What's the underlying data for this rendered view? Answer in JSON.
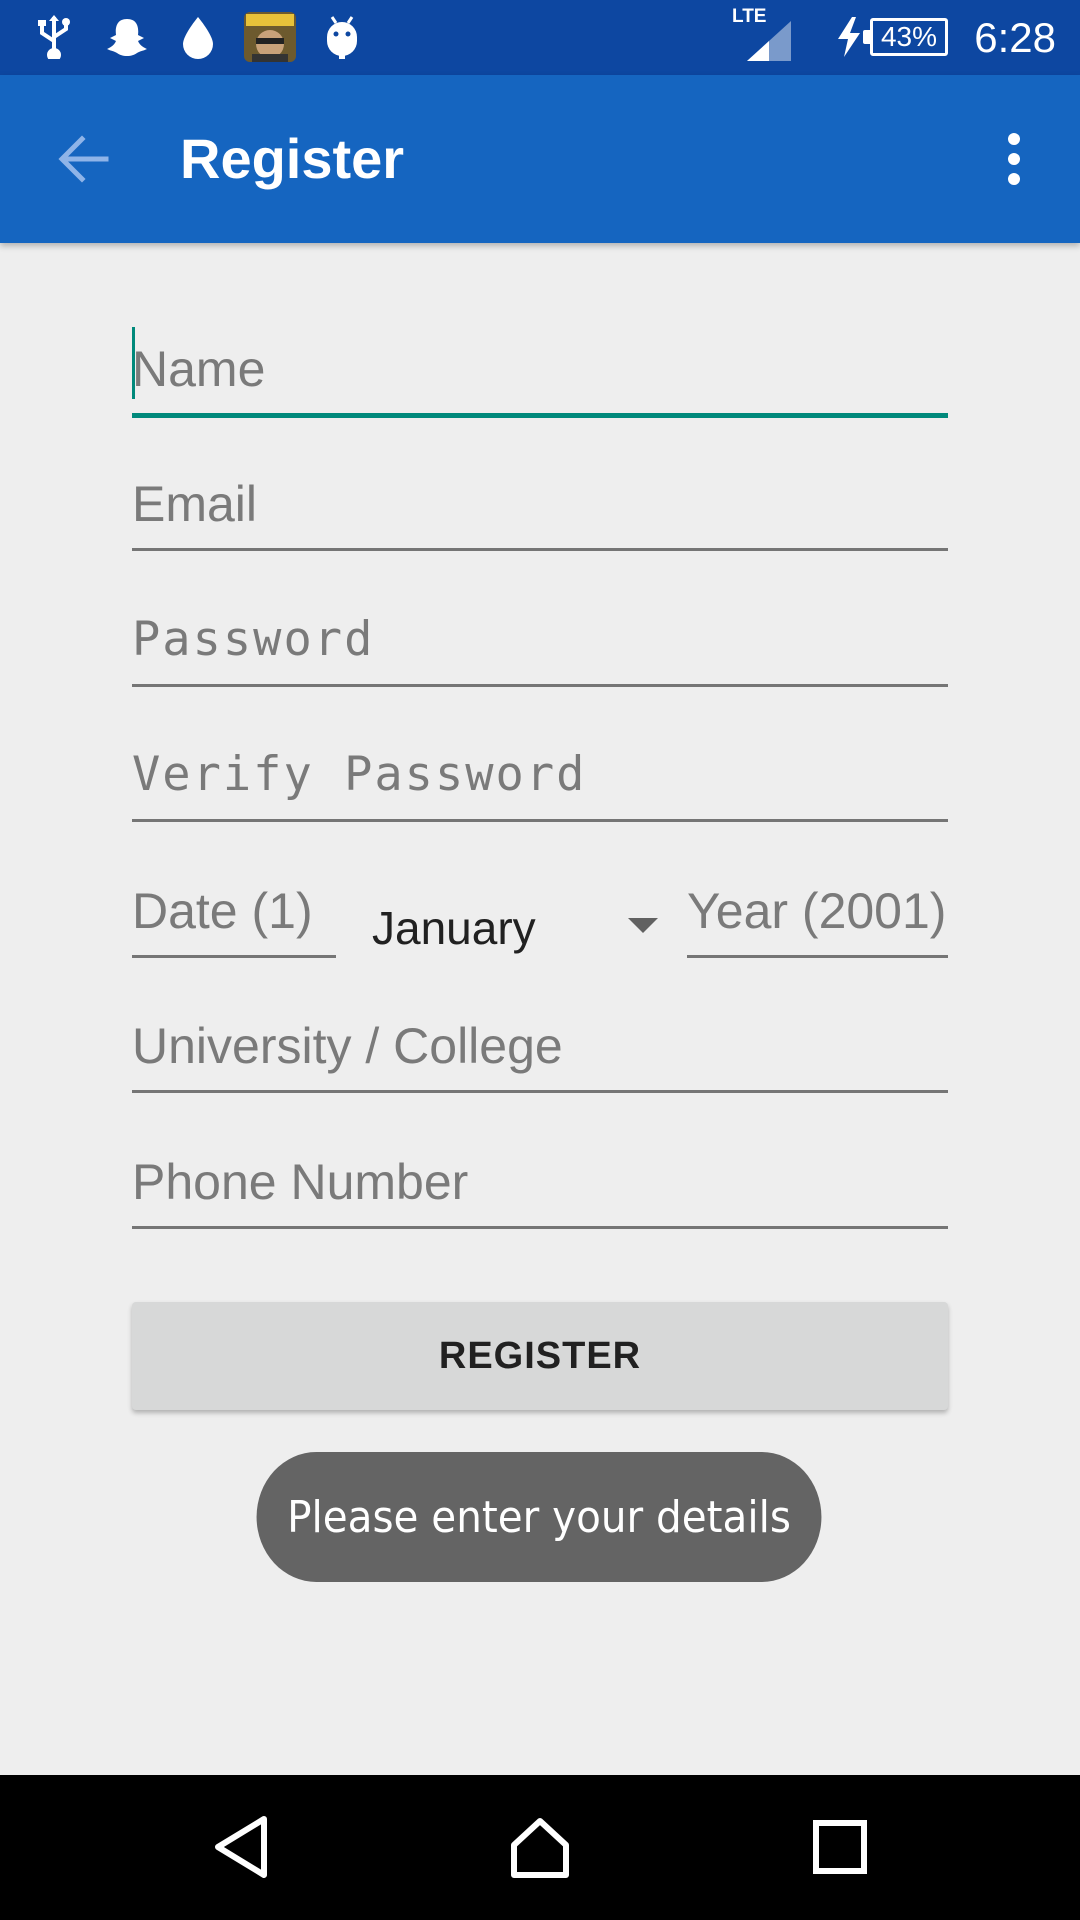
{
  "status_bar": {
    "time": "6:28",
    "battery": "43%",
    "network": "LTE",
    "left_icons": [
      "usb-icon",
      "snapchat-icon",
      "drop-icon",
      "game-app-icon",
      "android-icon"
    ],
    "right_icons": [
      "signal-icon",
      "charging-icon",
      "battery-icon"
    ]
  },
  "app_bar": {
    "title": "Register",
    "back_icon": "arrow-back-icon",
    "overflow_icon": "more-vert-icon",
    "color": "#1565c0"
  },
  "form": {
    "name": {
      "placeholder": "Name",
      "value": ""
    },
    "email": {
      "placeholder": "Email",
      "value": ""
    },
    "password": {
      "placeholder": "Password",
      "value": ""
    },
    "verify_password": {
      "placeholder": "Verify Password",
      "value": ""
    },
    "date": {
      "placeholder": "Date (1)",
      "value": ""
    },
    "month": {
      "selected": "January"
    },
    "year": {
      "placeholder": "Year (2001)",
      "value": ""
    },
    "university": {
      "placeholder": "University / College",
      "value": ""
    },
    "phone": {
      "placeholder": "Phone Number",
      "value": ""
    },
    "accent_color": "#00897b"
  },
  "register_button": {
    "label": "REGISTER"
  },
  "toast": {
    "message": "Please enter your details"
  },
  "nav_bar": {
    "icons": [
      "back-triangle-icon",
      "home-icon",
      "recents-icon"
    ]
  }
}
